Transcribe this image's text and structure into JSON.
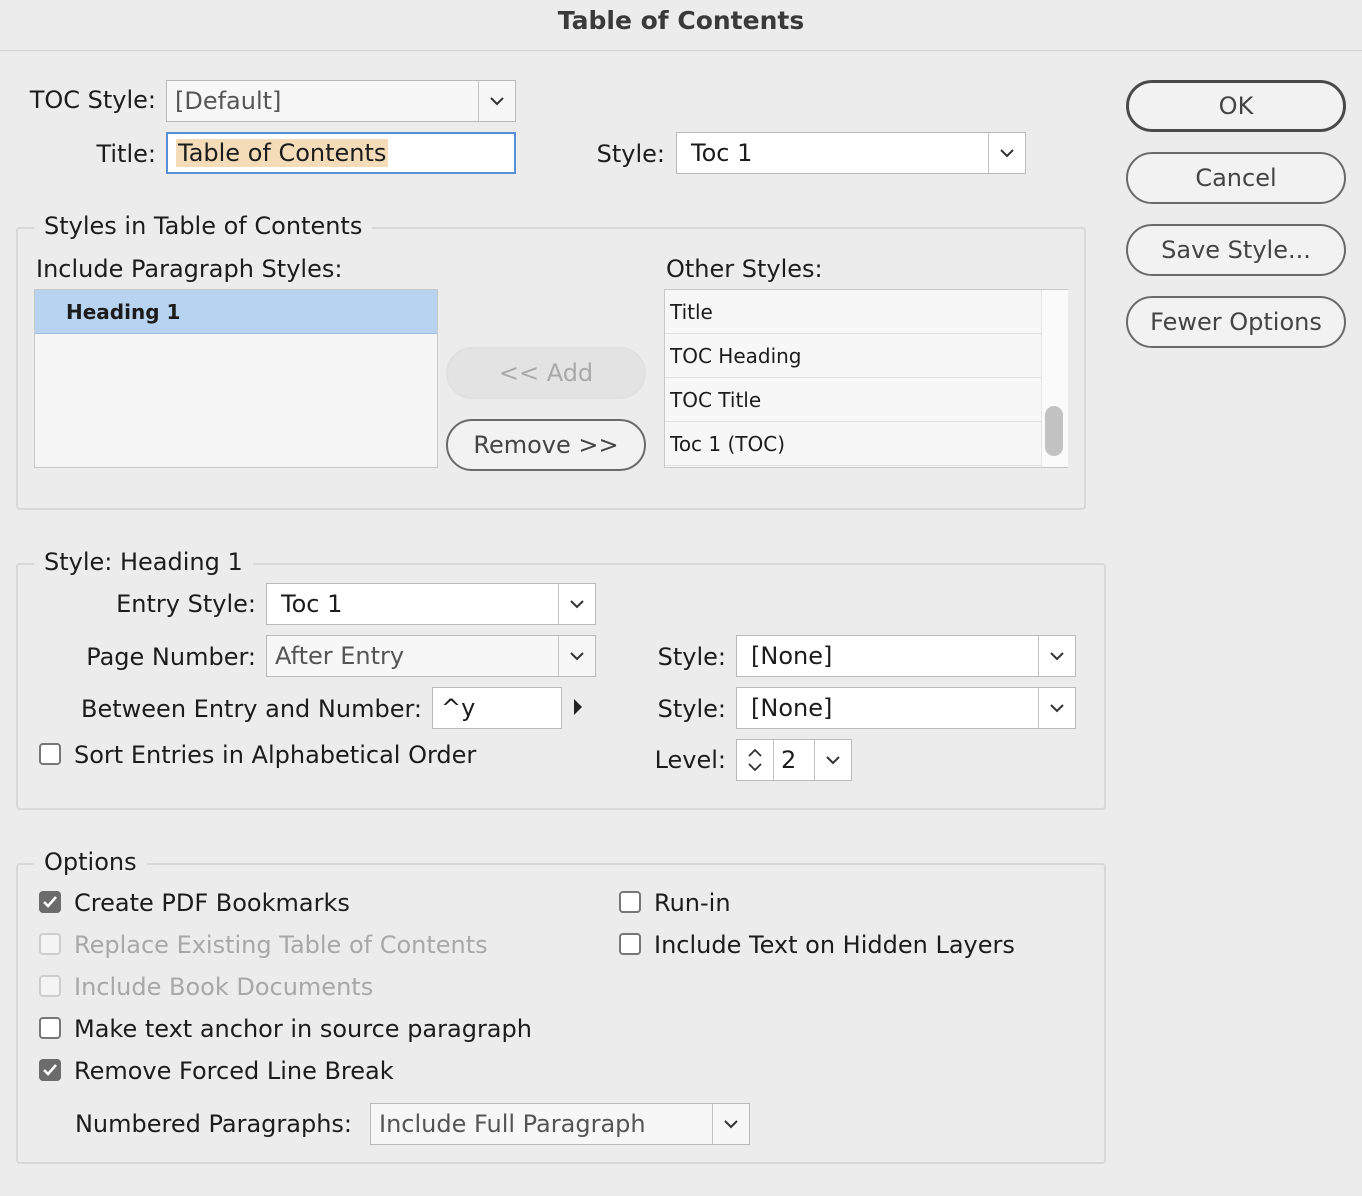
{
  "window": {
    "title": "Table of Contents"
  },
  "top": {
    "toc_style_label": "TOC Style:",
    "toc_style_value": "[Default]",
    "title_label": "Title:",
    "title_value": "Table of Contents",
    "style_label": "Style:",
    "style_value": "Toc 1"
  },
  "buttons": {
    "ok": "OK",
    "cancel": "Cancel",
    "save_style": "Save Style...",
    "fewer_options": "Fewer Options"
  },
  "styles_group": {
    "legend": "Styles in Table of Contents",
    "include_label": "Include Paragraph Styles:",
    "include_items": [
      "Heading 1"
    ],
    "add_label": "<< Add",
    "remove_label": "Remove >>",
    "other_label": "Other Styles:",
    "other_items": [
      "Title",
      "TOC Heading",
      "TOC Title",
      "Toc 1 (TOC)"
    ]
  },
  "style_group": {
    "legend": "Style: Heading 1",
    "entry_style_label": "Entry Style:",
    "entry_style_value": "Toc 1",
    "page_number_label": "Page Number:",
    "page_number_value": "After Entry",
    "page_style_label": "Style:",
    "page_style_value": "[None]",
    "between_label": "Between Entry and Number:",
    "between_value": "^y",
    "between_style_label": "Style:",
    "between_style_value": "[None]",
    "sort_label": "Sort Entries in Alphabetical Order",
    "sort_checked": false,
    "level_label": "Level:",
    "level_value": "2"
  },
  "options_group": {
    "legend": "Options",
    "create_pdf": "Create PDF Bookmarks",
    "replace_existing": "Replace Existing Table of Contents",
    "include_book": "Include Book Documents",
    "make_anchor": "Make text anchor in source paragraph",
    "remove_forced": "Remove Forced Line Break",
    "run_in": "Run-in",
    "include_hidden": "Include Text on Hidden Layers",
    "numbered_label": "Numbered Paragraphs:",
    "numbered_value": "Include Full Paragraph"
  },
  "colors": {
    "selection": "#b8d3f0",
    "focus": "#5a8fd6",
    "title_highlight": "#f5dcb8"
  }
}
